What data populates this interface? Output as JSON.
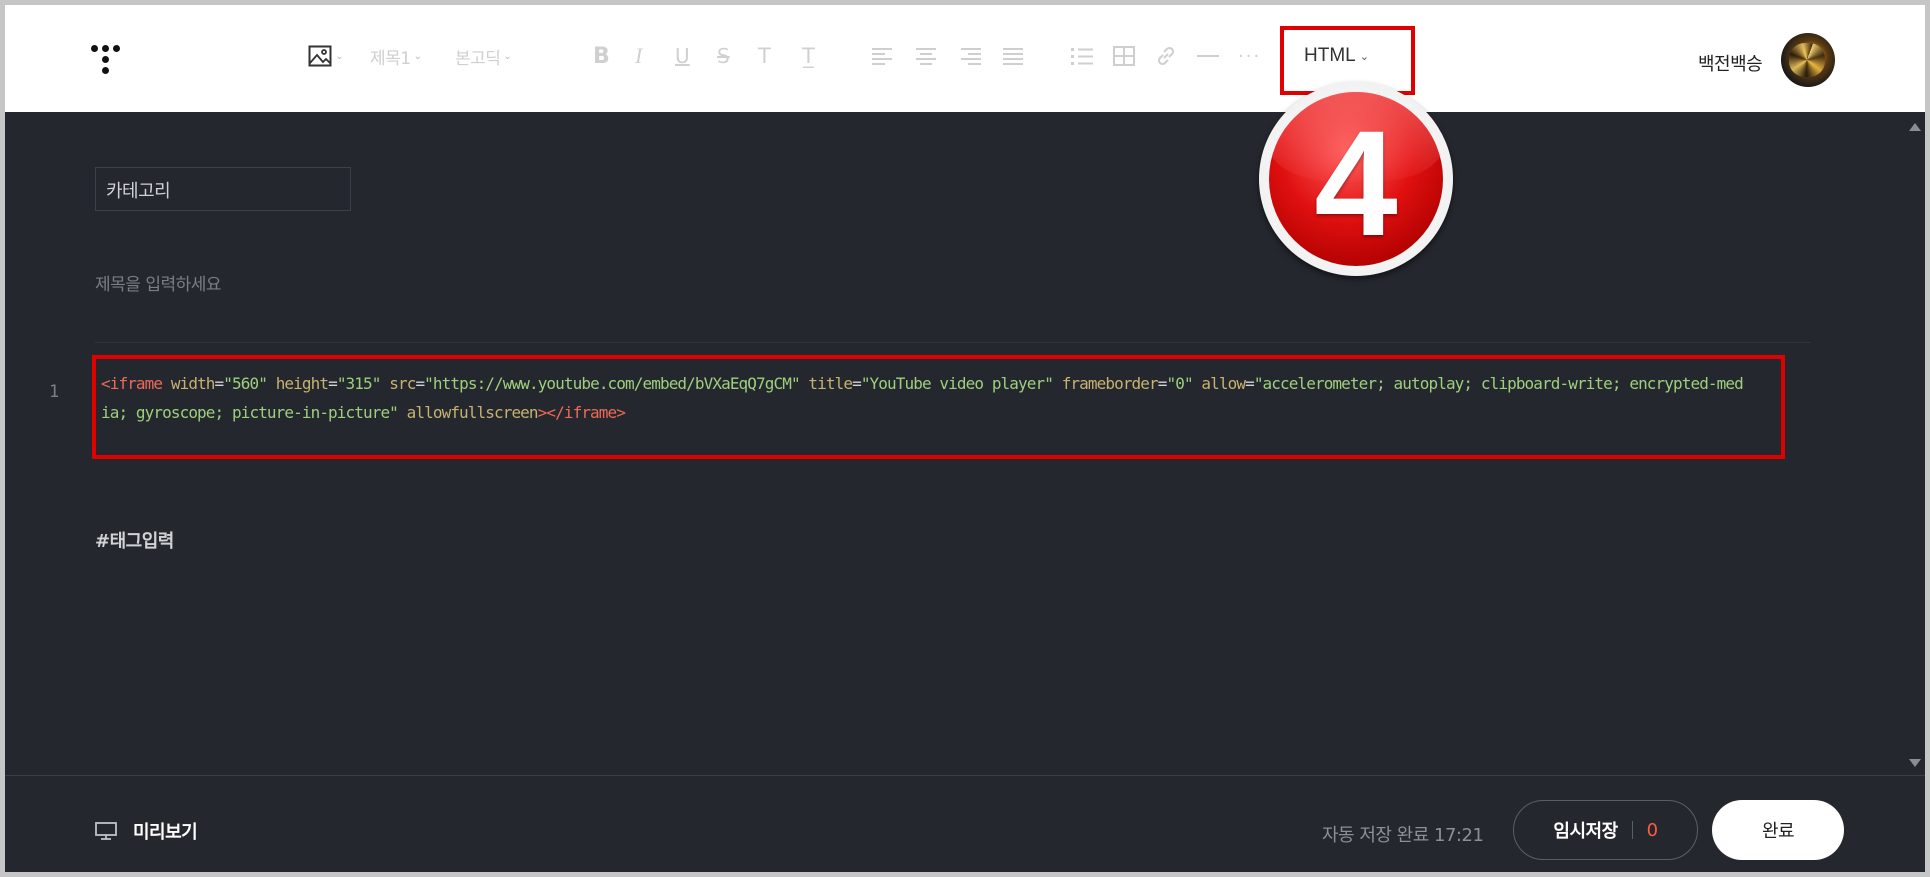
{
  "toolbar": {
    "heading_select": "제목1",
    "font_select": "본고딕",
    "mode_select": "HTML"
  },
  "user": {
    "name": "백전백승"
  },
  "editor": {
    "category_label": "카테고리",
    "title_placeholder": "제목을 입력하세요",
    "line_number": "1",
    "code": {
      "open_tag": "<iframe",
      "attrs": [
        {
          "name": "width",
          "value": "\"560\""
        },
        {
          "name": "height",
          "value": "\"315\""
        },
        {
          "name": "src",
          "value": "\"https://www.youtube.com/embed/bVXaEqQ7gCM\""
        },
        {
          "name": "title",
          "value": "\"YouTube video player\""
        },
        {
          "name": "frameborder",
          "value": "\"0\""
        },
        {
          "name": "allow",
          "value": "\"accelerometer; autoplay; clipboard-write; encrypted-media; gyroscope; picture-in-picture\""
        }
      ],
      "flag_attr": "allowfullscreen",
      "close_tag": "></iframe>"
    },
    "tag_input": "#태그입력"
  },
  "footer": {
    "preview_label": "미리보기",
    "autosave_text": "자동 저장 완료 17:21",
    "draft_label": "임시저장",
    "draft_count": "0",
    "done_label": "완료"
  },
  "annotation": {
    "step_number": "4",
    "highlight_color": "#e00000"
  }
}
